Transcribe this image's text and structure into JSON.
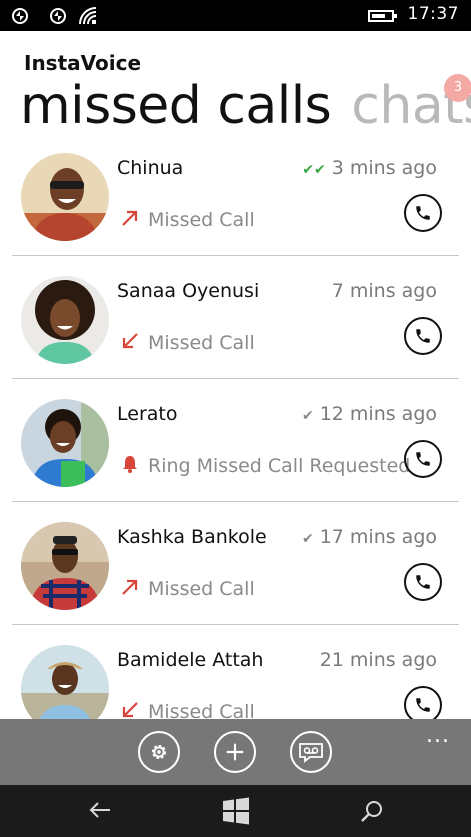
{
  "status_bar": {
    "time": "17:37",
    "icons": [
      "sync-icon",
      "sync-icon",
      "wifi-icon",
      "battery-icon"
    ]
  },
  "app": {
    "title": "InstaVoice",
    "pivot_active": "missed calls",
    "pivot_inactive": "chats",
    "chats_badge": "3"
  },
  "calls": [
    {
      "name": "Chinua",
      "time": "3 mins ago",
      "delivery": "double-check",
      "status": "Missed Call",
      "direction": "outgoing"
    },
    {
      "name": "Sanaa Oyenusi",
      "time": "7 mins ago",
      "delivery": "none",
      "status": "Missed Call",
      "direction": "incoming"
    },
    {
      "name": "Lerato",
      "time": "12 mins ago",
      "delivery": "single-check",
      "status": "Ring Missed Call Requested",
      "direction": "ring"
    },
    {
      "name": "Kashka Bankole",
      "time": "17 mins ago",
      "delivery": "single-check",
      "status": "Missed Call",
      "direction": "outgoing"
    },
    {
      "name": "Bamidele Attah",
      "time": "21 mins ago",
      "delivery": "none",
      "status": "Missed Call",
      "direction": "incoming"
    }
  ],
  "app_bar": {
    "buttons": [
      "settings-icon",
      "add-icon",
      "voicemail-icon"
    ],
    "more": "..."
  },
  "nav_bar": [
    "back-icon",
    "windows-icon",
    "search-icon"
  ],
  "colors": {
    "accent_red": "#d9453b",
    "badge": "#f4a9a5",
    "check_green": "#3aa845",
    "app_bar": "#777777",
    "nav_bar": "#1b1b1b"
  }
}
